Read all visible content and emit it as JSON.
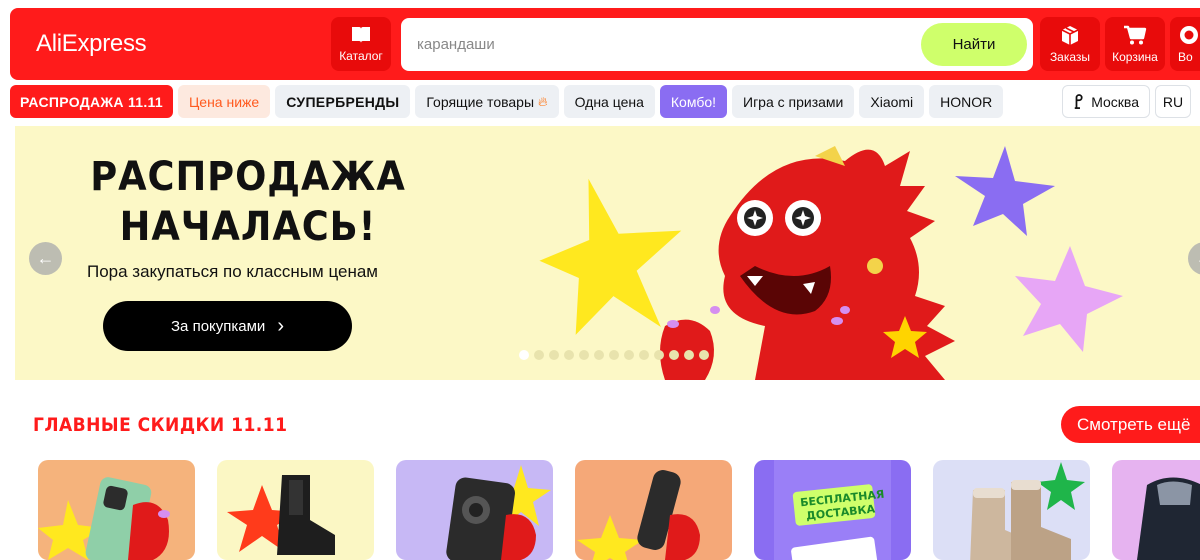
{
  "header": {
    "logo": "AliExpress",
    "catalog_label": "Каталог",
    "search_placeholder": "карандаши",
    "search_button": "Найти",
    "orders_label": "Заказы",
    "cart_label": "Корзина",
    "login_label": "Во"
  },
  "nav": {
    "items": [
      "РАСПРОДАЖА 11.11",
      "Цена ниже",
      "СУПЕРБРЕНДЫ",
      "Горящие товары",
      "Одна цена",
      "Комбо!",
      "Игра с призами",
      "Xiaomi",
      "HONOR"
    ],
    "city": "Москва",
    "language": "RU"
  },
  "banner": {
    "title_line1": "РАСПРОДАЖА",
    "title_line2": "НАЧАЛАСЬ!",
    "subtitle": "Пора закупаться по классным ценам",
    "button": "За покупками",
    "slides": 13,
    "active_slide": 1
  },
  "section": {
    "title": "ГЛАВНЫЕ СКИДКИ 11.11",
    "see_all": "Смотреть ещё",
    "free_delivery_line1": "БЕСПЛАТНАЯ",
    "free_delivery_line2": "ДОСТАВКА"
  },
  "colors": {
    "brand_red": "#ff1b1b",
    "search_button": "#cfff6b",
    "combo_chip": "#8a6df2",
    "banner_bg": "#fcf8c6"
  }
}
